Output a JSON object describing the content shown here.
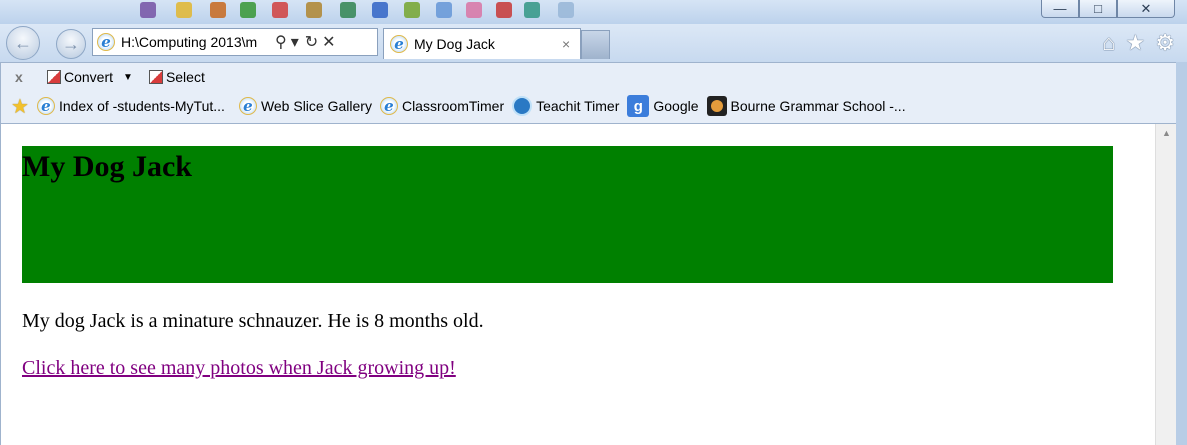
{
  "window": {
    "min": "—",
    "max": "□",
    "close": "✕"
  },
  "nav": {
    "address_url": "H:\\Computing 2013\\m",
    "search_glyph": "⚲",
    "dropdown_glyph": "▾",
    "refresh_glyph": "↻",
    "stop_glyph": "✕",
    "back_glyph": "←",
    "forward_glyph": "→"
  },
  "tab": {
    "title": "My Dog Jack",
    "close": "×"
  },
  "toolbar_icons": [
    "home-icon",
    "star-icon",
    "gear-icon"
  ],
  "command_bar": {
    "close": "x",
    "convert_label": "Convert",
    "select_label": "Select"
  },
  "favorites": [
    {
      "label": "Index of -students-MyTut...",
      "icon": "ie-page-icon"
    },
    {
      "label": "Web Slice Gallery",
      "icon": "ie-page-icon"
    },
    {
      "label": "ClassroomTimer",
      "icon": "ie-page-icon"
    },
    {
      "label": "Teachit Timer",
      "icon": "teachit-icon"
    },
    {
      "label": "Google",
      "icon": "google-icon"
    },
    {
      "label": "Bourne Grammar School -...",
      "icon": "school-icon"
    }
  ],
  "page": {
    "heading": "My Dog Jack",
    "paragraph": "My dog Jack is a minature schnauzer. He is 8 months old.",
    "link": "Click here to see many photos when Jack growing up!",
    "banner_color": "#008000",
    "link_color": "#800080"
  }
}
